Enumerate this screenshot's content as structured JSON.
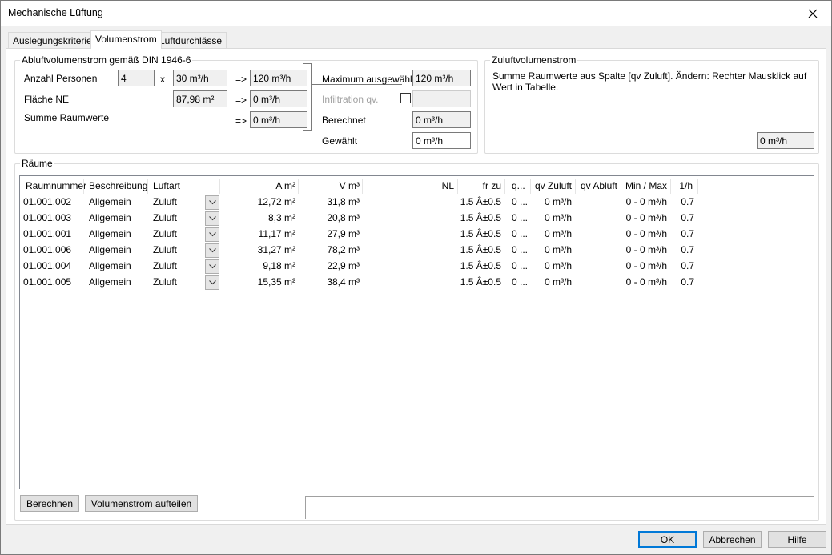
{
  "window": {
    "title": "Mechanische Lüftung"
  },
  "tabs": [
    {
      "label": "Auslegungskriterien",
      "active": false
    },
    {
      "label": "Volumenstrom",
      "active": true
    },
    {
      "label": "Luftdurchlässe",
      "active": false
    }
  ],
  "abluft": {
    "group_label": "Abluftvolumenstrom gemäß DIN 1946-6",
    "personen_label": "Anzahl Personen",
    "personen_value": "4",
    "times": "x",
    "per_person_value": "30 m³/h",
    "arrow": "=>",
    "personen_result": "120 m³/h",
    "flaeche_label": "Fläche NE",
    "flaeche_value": "87,98 m²",
    "flaeche_result": "0 m³/h",
    "summe_label": "Summe Raumwerte",
    "summe_result": "0 m³/h",
    "max_label": "Maximum ausgewählt",
    "max_value": "120 m³/h",
    "infiltration_label": "Infiltration qv.",
    "infiltration_value": "",
    "berechnet_label": "Berechnet",
    "berechnet_value": "0 m³/h",
    "gewaehlt_label": "Gewählt",
    "gewaehlt_value": "0 m³/h"
  },
  "zuluft": {
    "group_label": "Zuluftvolumenstrom",
    "description": "Summe Raumwerte aus Spalte [qv Zuluft]. Ändern: Rechter Mausklick auf Wert in Tabelle.",
    "value": "0 m³/h"
  },
  "raeume": {
    "group_label": "Räume",
    "columns": [
      "Raumnummer",
      "Beschreibung",
      "Luftart",
      "A m²",
      "V m³",
      "NL",
      "fr zu",
      "q...",
      "qv Zuluft",
      "qv Abluft",
      "Min / Max",
      "1/h"
    ],
    "rows": [
      {
        "raumnummer": "01.001.002",
        "beschreibung": "Allgemein",
        "luftart": "Zuluft",
        "a": "12,72 m²",
        "v": "31,8 m³",
        "nl": "",
        "frzu": "1.5 Â±0.5",
        "q": "0 ...",
        "qvzu": "0 m³/h",
        "qvab": "",
        "minmax": "0 - 0 m³/h",
        "h": "0.7"
      },
      {
        "raumnummer": "01.001.003",
        "beschreibung": "Allgemein",
        "luftart": "Zuluft",
        "a": "8,3 m²",
        "v": "20,8 m³",
        "nl": "",
        "frzu": "1.5 Â±0.5",
        "q": "0 ...",
        "qvzu": "0 m³/h",
        "qvab": "",
        "minmax": "0 - 0 m³/h",
        "h": "0.7"
      },
      {
        "raumnummer": "01.001.001",
        "beschreibung": "Allgemein",
        "luftart": "Zuluft",
        "a": "11,17 m²",
        "v": "27,9 m³",
        "nl": "",
        "frzu": "1.5 Â±0.5",
        "q": "0 ...",
        "qvzu": "0 m³/h",
        "qvab": "",
        "minmax": "0 - 0 m³/h",
        "h": "0.7"
      },
      {
        "raumnummer": "01.001.006",
        "beschreibung": "Allgemein",
        "luftart": "Zuluft",
        "a": "31,27 m²",
        "v": "78,2 m³",
        "nl": "",
        "frzu": "1.5 Â±0.5",
        "q": "0 ...",
        "qvzu": "0 m³/h",
        "qvab": "",
        "minmax": "0 - 0 m³/h",
        "h": "0.7"
      },
      {
        "raumnummer": "01.001.004",
        "beschreibung": "Allgemein",
        "luftart": "Zuluft",
        "a": "9,18 m²",
        "v": "22,9 m³",
        "nl": "",
        "frzu": "1.5 Â±0.5",
        "q": "0 ...",
        "qvzu": "0 m³/h",
        "qvab": "",
        "minmax": "0 - 0 m³/h",
        "h": "0.7"
      },
      {
        "raumnummer": "01.001.005",
        "beschreibung": "Allgemein",
        "luftart": "Zuluft",
        "a": "15,35 m²",
        "v": "38,4 m³",
        "nl": "",
        "frzu": "1.5 Â±0.5",
        "q": "0 ...",
        "qvzu": "0 m³/h",
        "qvab": "",
        "minmax": "0 - 0 m³/h",
        "h": "0.7"
      }
    ]
  },
  "actions": {
    "berechnen": "Berechnen",
    "aufteilen": "Volumenstrom aufteilen",
    "status": ""
  },
  "footer": {
    "ok": "OK",
    "abbrechen": "Abbrechen",
    "hilfe": "Hilfe"
  },
  "icons": {
    "close": "close-icon",
    "dropdown": "chevron-down-icon"
  },
  "colors": {
    "accent": "#0078d7",
    "field_bg": "#f0f0f0",
    "panel_bg": "#ffffff"
  }
}
